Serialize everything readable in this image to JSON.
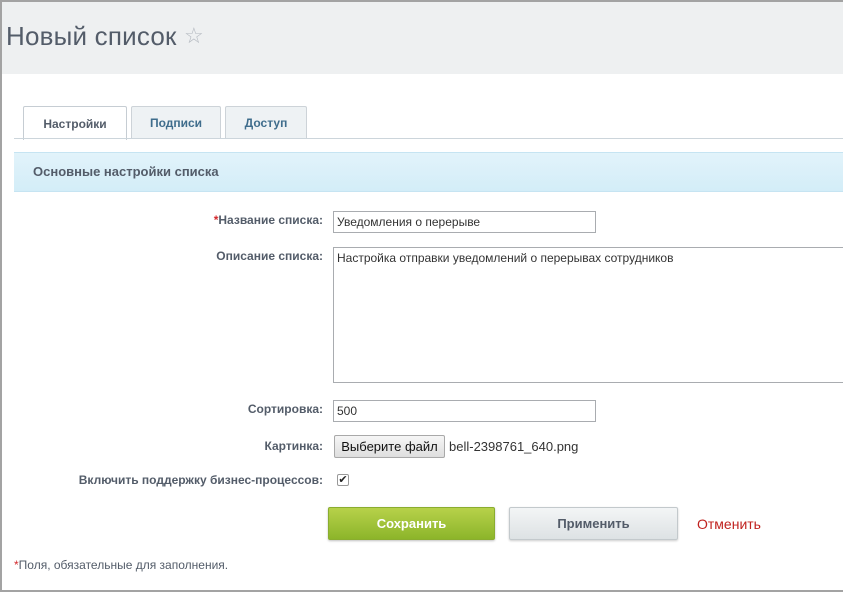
{
  "header": {
    "title": "Новый список",
    "star_icon": "☆"
  },
  "tabs": [
    {
      "label": "Настройки",
      "active": true
    },
    {
      "label": "Подписи",
      "active": false
    },
    {
      "label": "Доступ",
      "active": false
    }
  ],
  "section": {
    "title": "Основные настройки списка"
  },
  "form": {
    "name": {
      "required_mark": "*",
      "label": "Название списка:",
      "value": "Уведомления о перерыве"
    },
    "description": {
      "label": "Описание списка:",
      "value": "Настройка отправки уведомлений о перерывах сотрудников"
    },
    "sort": {
      "label": "Сортировка:",
      "value": "500"
    },
    "picture": {
      "label": "Картинка:",
      "button_label": "Выберите файл",
      "file_name": "bell-2398761_640.png"
    },
    "bizproc": {
      "label": "Включить поддержку бизнес-процессов:",
      "checked": true,
      "check_glyph": "✔"
    }
  },
  "actions": {
    "save_label": "Сохранить",
    "apply_label": "Применить",
    "cancel_label": "Отменить"
  },
  "footer": {
    "required_mark": "*",
    "note": "Поля, обязательные для заполнения."
  },
  "colors": {
    "accent_green": "#9bc13a",
    "section_bg": "#d9f0fa",
    "cancel_red": "#c0221f",
    "required_red": "#d3292c"
  }
}
